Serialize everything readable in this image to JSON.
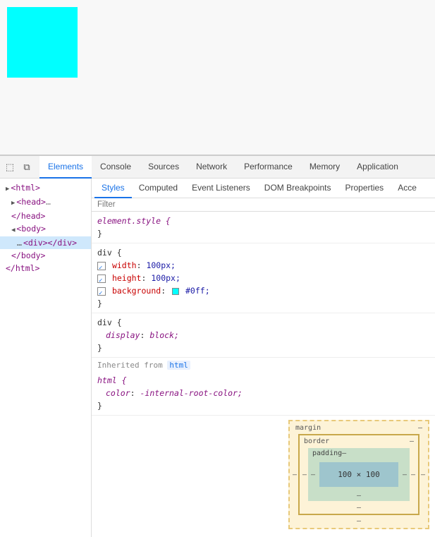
{
  "preview": {
    "box_color": "#00ffff"
  },
  "devtools": {
    "main_tabs": [
      {
        "label": "Elements",
        "active": true
      },
      {
        "label": "Console",
        "active": false
      },
      {
        "label": "Sources",
        "active": false
      },
      {
        "label": "Network",
        "active": false
      },
      {
        "label": "Performance",
        "active": false
      },
      {
        "label": "Memory",
        "active": false
      },
      {
        "label": "Application",
        "active": false
      }
    ],
    "sub_tabs": [
      {
        "label": "Styles",
        "active": true
      },
      {
        "label": "Computed",
        "active": false
      },
      {
        "label": "Event Listeners",
        "active": false
      },
      {
        "label": "DOM Breakpoints",
        "active": false
      },
      {
        "label": "Properties",
        "active": false
      },
      {
        "label": "Acce",
        "active": false
      }
    ],
    "filter_placeholder": "Filter",
    "dom_tree": {
      "lines": [
        {
          "text": "<html>",
          "indent": 0,
          "tag": true,
          "triangle": "closed",
          "selected": false
        },
        {
          "text": "▶ <head>…",
          "indent": 1,
          "tag": true,
          "triangle": "none",
          "selected": false
        },
        {
          "text": "</head>",
          "indent": 1,
          "tag": true,
          "triangle": "none",
          "selected": false
        },
        {
          "text": "▼ <body>",
          "indent": 1,
          "tag": true,
          "triangle": "none",
          "selected": false
        },
        {
          "text": "…  <div></div>",
          "indent": 2,
          "tag": true,
          "triangle": "none",
          "selected": true
        },
        {
          "text": "</body>",
          "indent": 1,
          "tag": true,
          "triangle": "none",
          "selected": false
        },
        {
          "text": "</html>",
          "indent": 0,
          "tag": true,
          "triangle": "none",
          "selected": false
        }
      ]
    },
    "styles": {
      "element_style_selector": "element.style {",
      "element_style_close": "}",
      "div_rules": [
        {
          "selector": "div {",
          "properties": [
            {
              "checked": true,
              "name": "width",
              "value": "100px;"
            },
            {
              "checked": true,
              "name": "height",
              "value": "100px;"
            },
            {
              "checked": true,
              "name": "background",
              "value": "#0ff;",
              "has_swatch": true
            }
          ],
          "close": "}"
        }
      ],
      "div_display_rule": {
        "selector": "div {",
        "properties": [
          {
            "checked": false,
            "name": "display",
            "value": "block;"
          }
        ],
        "close": "}"
      },
      "inherited_label": "Inherited from",
      "inherited_tag": "html",
      "html_rule": {
        "selector": "html {",
        "properties": [
          {
            "name": "color",
            "value": "-internal-root-color;"
          }
        ],
        "close": "}"
      }
    },
    "box_model": {
      "margin_label": "margin",
      "margin_dash": "–",
      "border_label": "border",
      "border_dash": "–",
      "padding_label": "padding–",
      "content_label": "100 × 100",
      "bottom_dash": "–",
      "left_dash": "–",
      "right_dash": "–"
    }
  }
}
